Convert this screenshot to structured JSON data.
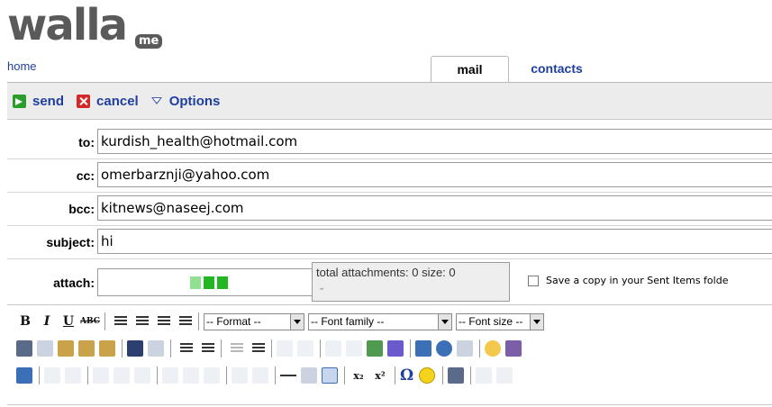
{
  "logo": {
    "word": "walla",
    "badge": "me"
  },
  "nav": {
    "home": "home"
  },
  "tabs": [
    {
      "label": "mail",
      "active": true
    },
    {
      "label": "contacts",
      "active": false
    }
  ],
  "toolbar": {
    "send": "send",
    "cancel": "cancel",
    "options": "Options"
  },
  "form": {
    "to": {
      "label": "to:",
      "value": "kurdish_health@hotmail.com"
    },
    "cc": {
      "label": "cc:",
      "value": "omerbarznji@yahoo.com"
    },
    "bcc": {
      "label": "bcc:",
      "value": "kitnews@naseej.com"
    },
    "subject": {
      "label": "subject:",
      "value": "hi"
    },
    "attach": {
      "label": "attach:",
      "info": "total attachments: 0 size: 0"
    },
    "save_copy": "Save a copy in your Sent Items folde"
  },
  "editor": {
    "format": "-- Format --",
    "font_family": "-- Font family --",
    "font_size": "-- Font size --",
    "bold": "B",
    "italic": "I",
    "underline": "U",
    "strike": "ABC",
    "omega": "Ω"
  },
  "colors": {
    "link": "#1f3f9f",
    "toolbar_bg": "#ececec",
    "send_green": "#2a9d2a",
    "cancel_red": "#d42828"
  }
}
